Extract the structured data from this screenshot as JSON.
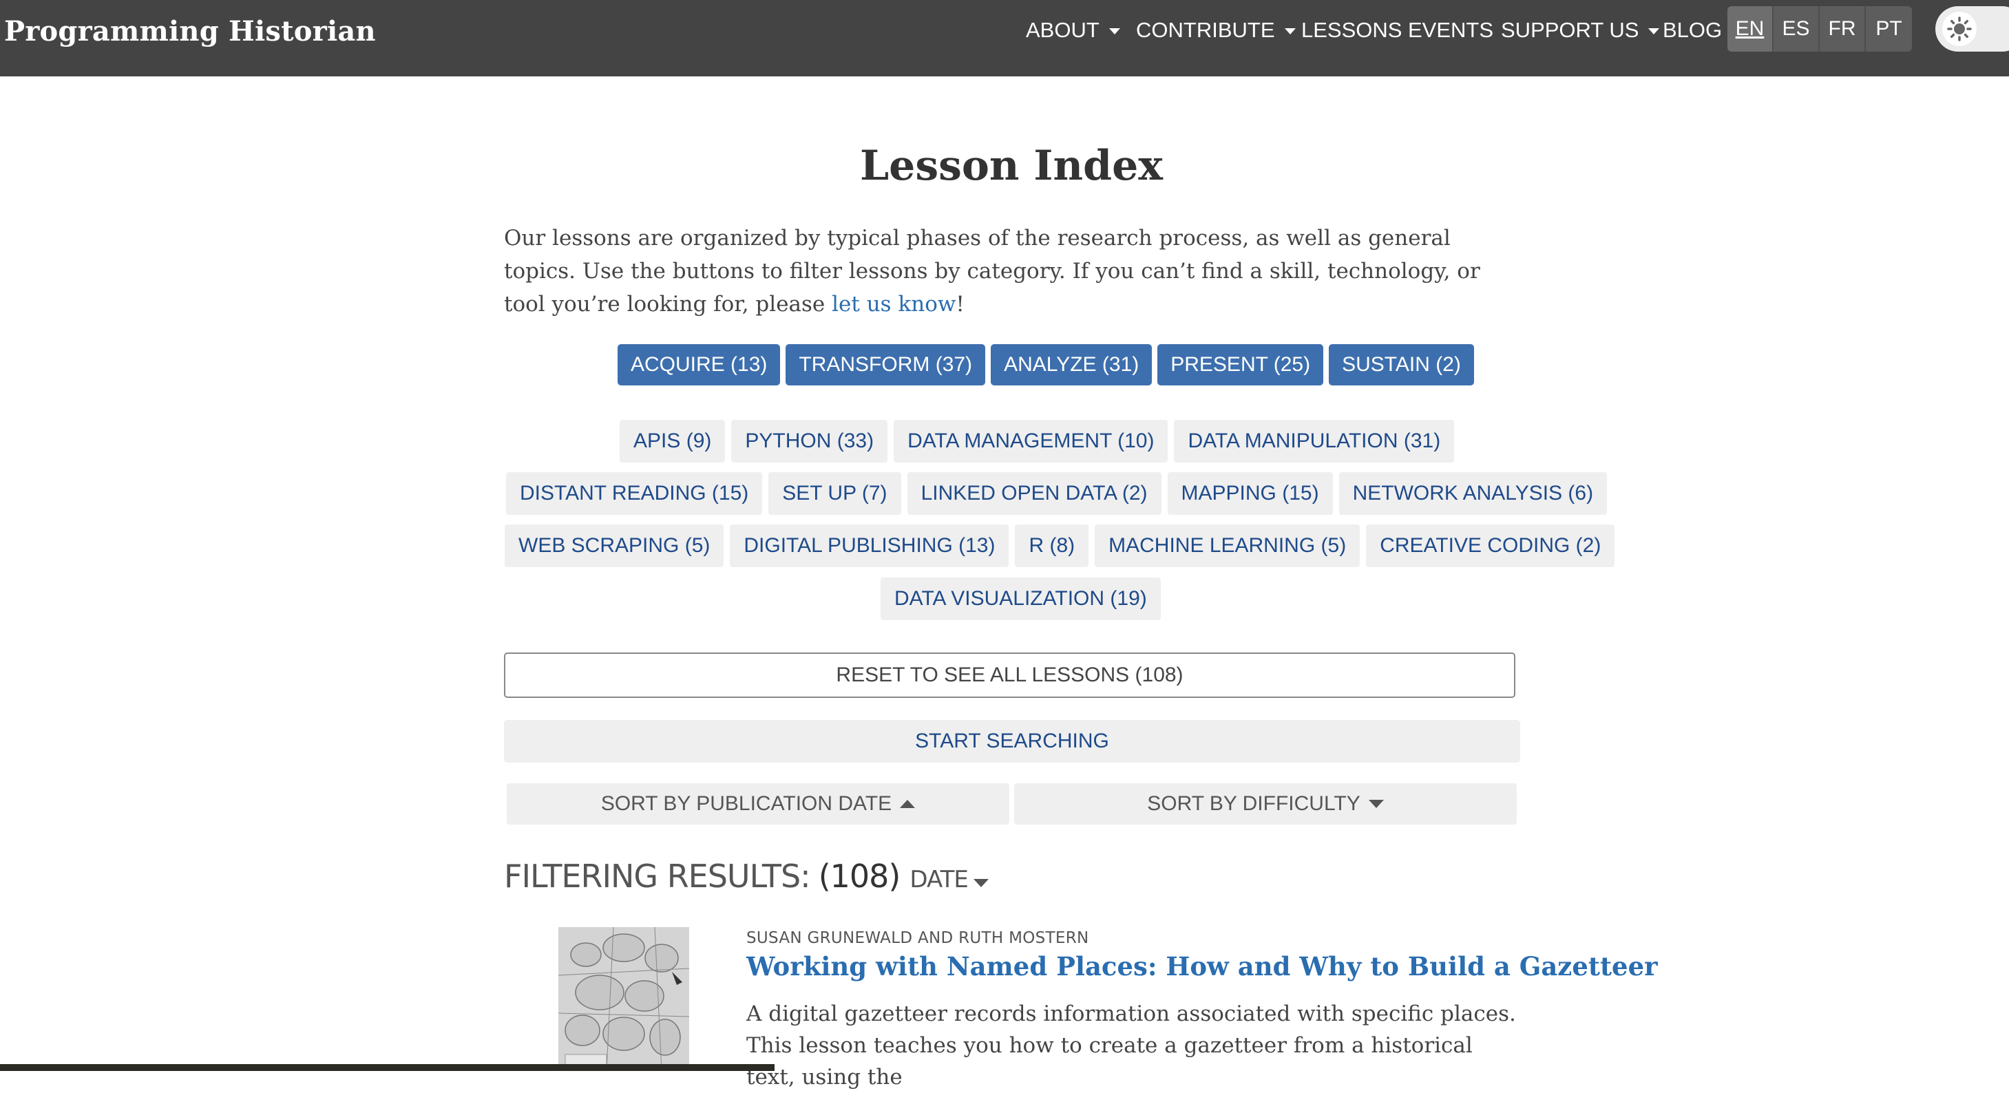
{
  "navbar": {
    "brand": "Programming Historian",
    "items": [
      {
        "label": "ABOUT",
        "dropdown": true
      },
      {
        "label": "CONTRIBUTE",
        "dropdown": true
      },
      {
        "label": "LESSONS",
        "dropdown": false
      },
      {
        "label": "EVENTS",
        "dropdown": false
      },
      {
        "label": "SUPPORT US",
        "dropdown": true
      },
      {
        "label": "BLOG",
        "dropdown": false
      }
    ],
    "languages": [
      "EN",
      "ES",
      "FR",
      "PT"
    ],
    "active_language": "EN",
    "theme_toggle_icon": "sun-icon"
  },
  "main": {
    "title": "Lesson Index",
    "intro_text": "Our lessons are organized by typical phases of the research process, as well as general topics. Use the buttons to filter lessons by category. If you can’t find a skill, technology, or tool you’re looking for, please ",
    "intro_link": "let us know",
    "intro_end": "!",
    "phases": [
      "ACQUIRE (13)",
      "TRANSFORM (37)",
      "ANALYZE (31)",
      "PRESENT (25)",
      "SUSTAIN (2)"
    ],
    "topics": [
      [
        "APIS (9)",
        "PYTHON (33)",
        "DATA MANAGEMENT (10)",
        "DATA MANIPULATION (31)"
      ],
      [
        "DISTANT READING (15)",
        "SET UP (7)",
        "LINKED OPEN DATA (2)",
        "MAPPING (15)",
        "NETWORK ANALYSIS (6)"
      ],
      [
        "WEB SCRAPING (5)",
        "DIGITAL PUBLISHING (13)",
        "R (8)",
        "MACHINE LEARNING (5)",
        "CREATIVE CODING (2)"
      ],
      [
        "DATA VISUALIZATION (19)"
      ]
    ],
    "reset_label": "RESET TO SEE ALL LESSONS (108)",
    "search_label": "START SEARCHING",
    "sort_date_label": "SORT BY PUBLICATION DATE",
    "sort_difficulty_label": "SORT BY DIFFICULTY",
    "results_label": "FILTERING RESULTS:",
    "results_count": "(108)",
    "results_sort": "DATE"
  },
  "lesson": {
    "author": "SUSAN GRUNEWALD AND RUTH MOSTERN",
    "title": "Working with Named Places: How and Why to Build a Gazetteer",
    "description": "A digital gazetteer records information associated with specific places. This lesson teaches you how to create a gazetteer from a historical text, using the"
  },
  "colors": {
    "navbar_bg": "#444444",
    "phase_button_bg": "#3d6fae",
    "topic_button_bg": "#efefef",
    "topic_text": "#1e4a8a",
    "link": "#2a6db0"
  }
}
